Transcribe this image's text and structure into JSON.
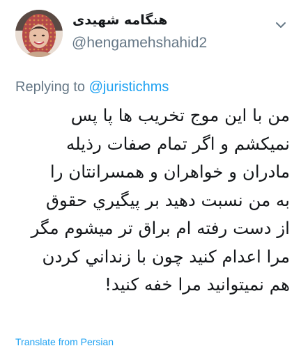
{
  "author": {
    "display_name": "هنگامه شهیدی",
    "handle": "@hengamehshahid2"
  },
  "reply": {
    "prefix": "Replying to",
    "mention": "@juristichms"
  },
  "body_lines": [
    "من با این موج تخریب ها پا پس",
    "نمیکشم و اگر تمام صفات رذیله",
    "مادران و خواهران و همسرانتان را",
    "به من نسبت دهید بر پیگیري حقوق",
    "از دست رفته ام براق تر میشوم مگر",
    "مرا اعدام کنید چون با زنداني کردن",
    "هم نمیتوانید مرا خفه کنید!"
  ],
  "translate_label": "Translate from Persian",
  "colors": {
    "link": "#1da1f2",
    "secondary": "#657786",
    "text": "#14171a"
  },
  "icons": {
    "menu": "chevron-down-icon"
  }
}
